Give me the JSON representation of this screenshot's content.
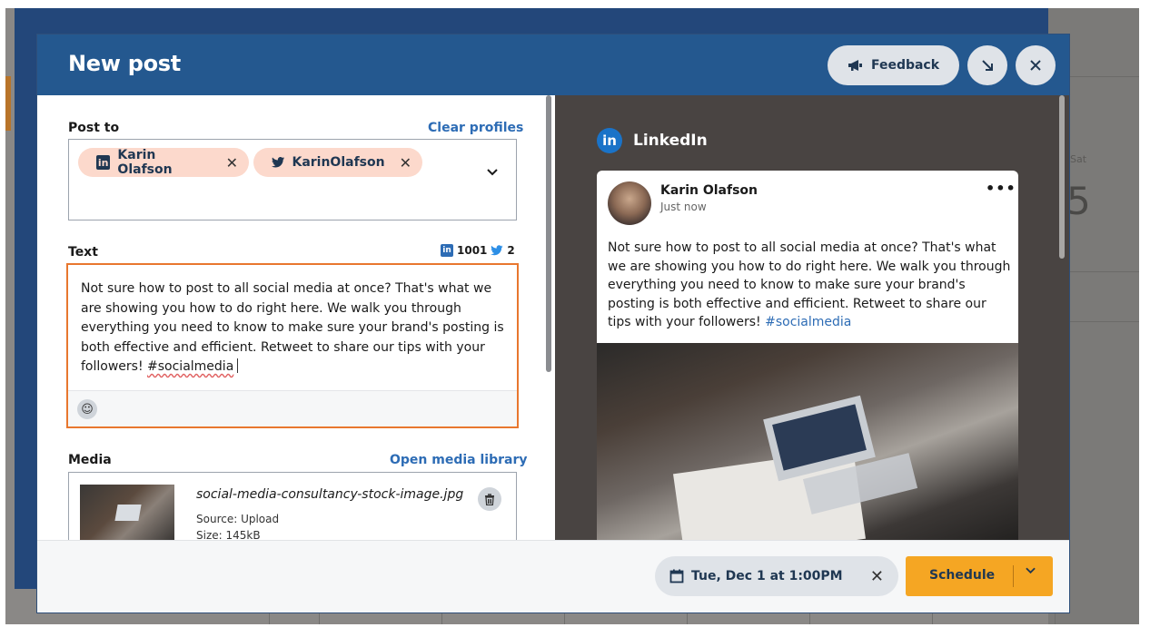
{
  "modal": {
    "title": "New post",
    "feedback_label": "Feedback"
  },
  "background": {
    "day_label": "Sat",
    "day_number": "5"
  },
  "post_to": {
    "label": "Post to",
    "clear_label": "Clear profiles",
    "profiles": [
      {
        "network": "linkedin",
        "name": "Karin Olafson",
        "icon": "linkedin-icon"
      },
      {
        "network": "twitter",
        "name": "KarinOlafson",
        "icon": "twitter-icon"
      }
    ]
  },
  "text_section": {
    "label": "Text",
    "linkedin_count": "1001",
    "twitter_count": "2",
    "body": "Not sure how to post to all social media at once? That's what we are showing you how to do right here. We walk you through everything you need to know to make sure your brand's posting is both effective and efficient. Retweet to share our tips with your followers! ",
    "hashtag": "#socialmedia"
  },
  "media": {
    "label": "Media",
    "open_library_label": "Open media library",
    "filename": "social-media-consultancy-stock-image.jpg",
    "source": "Source: Upload",
    "size": "Size: 145kB"
  },
  "preview": {
    "network_badge": "in",
    "network_title": "LinkedIn",
    "author": "Karin Olafson",
    "time": "Just now",
    "more": "•••",
    "body": "Not sure how to post to all social media at once? That's what we are showing you how to do right here. We walk you through everything you need to know to make sure your brand's posting is both effective and efficient. Retweet to share our tips with your followers! ",
    "hashtag": "#socialmedia"
  },
  "footer": {
    "date_label": "Tue, Dec 1 at 1:00PM",
    "schedule_label": "Schedule"
  },
  "colors": {
    "header": "#24588f",
    "accent_orange": "#f5a623",
    "focus_border": "#e8772e",
    "chip_bg": "#fcd9cc",
    "link": "#2d6cb5"
  }
}
